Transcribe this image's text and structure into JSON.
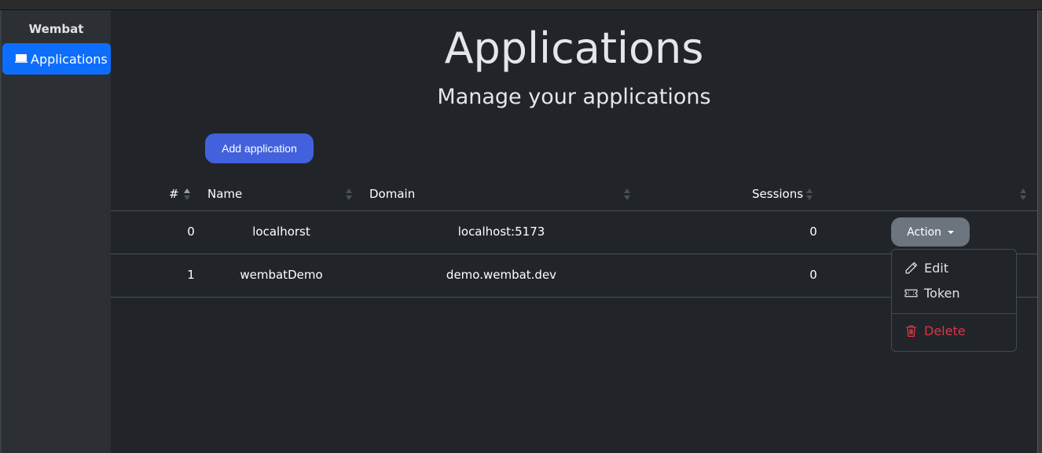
{
  "sidebar": {
    "brand": "Wembat",
    "items": [
      {
        "label": "Applications",
        "icon": "laptop-icon",
        "active": true
      }
    ]
  },
  "header": {
    "title": "Applications",
    "subtitle": "Manage your applications"
  },
  "toolbar": {
    "add_label": "Add application"
  },
  "table": {
    "columns": [
      {
        "label": "#",
        "sort": "asc"
      },
      {
        "label": "Name",
        "sort": "none"
      },
      {
        "label": "Domain",
        "sort": "none"
      },
      {
        "label": "Sessions",
        "sort": "none"
      },
      {
        "label": "",
        "sort": "none"
      }
    ],
    "rows": [
      {
        "id": "0",
        "name": "localhorst",
        "domain": "localhost:5173",
        "sessions": "0"
      },
      {
        "id": "1",
        "name": "wembatDemo",
        "domain": "demo.wembat.dev",
        "sessions": "0"
      }
    ]
  },
  "action": {
    "label": "Action",
    "menu": [
      {
        "label": "Edit",
        "icon": "pencil-icon"
      },
      {
        "label": "Token",
        "icon": "ticket-icon"
      },
      {
        "label": "Delete",
        "icon": "trash-icon",
        "color": "#dc3545"
      }
    ]
  }
}
